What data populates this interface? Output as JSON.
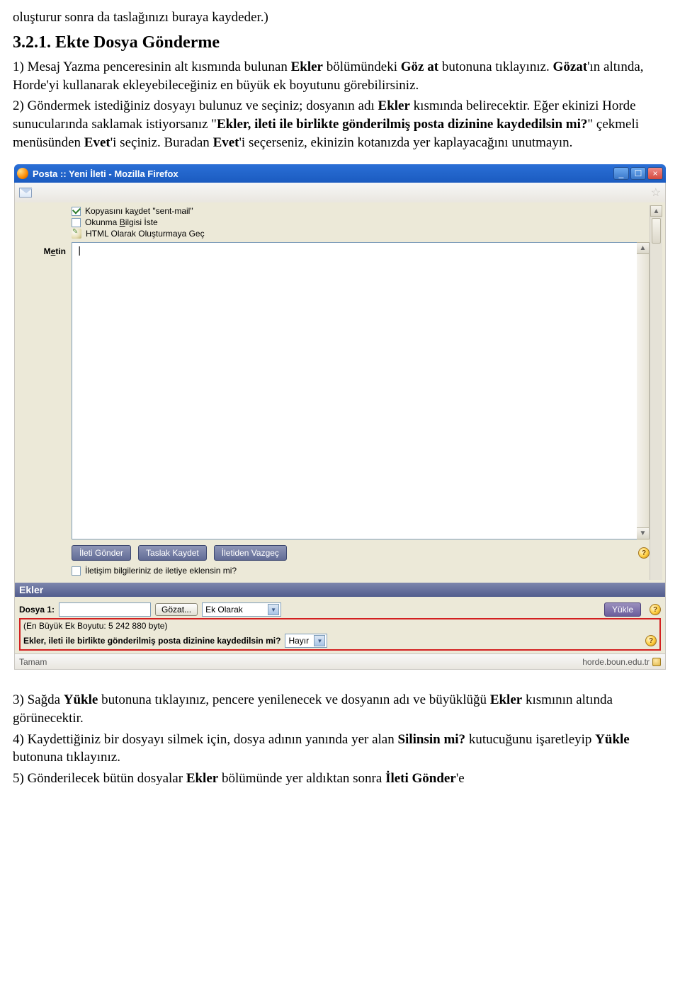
{
  "doc": {
    "pre_text": "oluşturur sonra da taslağınızı buraya kaydeder.)",
    "heading_num": "3.2.1. ",
    "heading_title": "Ekte Dosya Gönderme",
    "para1_a": "1) Mesaj Yazma penceresinin alt kısmında bulunan ",
    "para1_b": "Ekler",
    "para1_c": " bölümündeki ",
    "para1_d": "Göz at",
    "para1_e": " butonuna tıklayınız. ",
    "para1_f": "Gözat",
    "para1_g": "'ın altında, Horde'yi kullanarak ekleyebileceğiniz en büyük ek boyutunu görebilirsiniz.",
    "para2_a": "2) Göndermek istediğiniz dosyayı bulunuz ve seçiniz; dosyanın adı ",
    "para2_b": "Ekler",
    "para2_c": " kısmında belirecektir. Eğer ekinizi Horde sunucularında saklamak istiyorsanız \"",
    "para2_d": "Ekler, ileti ile birlikte gönderilmiş posta dizinine kaydedilsin mi?",
    "para2_e": "\" çekmeli menüsünden ",
    "para2_f": "Evet",
    "para2_g": "'i seçiniz. Buradan ",
    "para2_h": "Evet",
    "para2_i": "'i seçerseniz, ekinizin kotanızda yer kaplayacağını unutmayın.",
    "para3_a": "3) Sağda ",
    "para3_b": "Yükle",
    "para3_c": " butonuna tıklayınız, pencere yenilenecek ve dosyanın adı ve büyüklüğü ",
    "para3_d": "Ekler",
    "para3_e": " kısmının altında görünecektir.",
    "para4_a": "4) Kaydettiğiniz bir dosyayı silmek için, dosya adının yanında yer alan ",
    "para4_b": "Silinsin mi?",
    "para4_c": " kutucuğunu işaretleyip ",
    "para4_d": "Yükle",
    "para4_e": " butonuna tıklayınız.",
    "para5_a": "5) Gönderilecek bütün dosyalar ",
    "para5_b": "Ekler",
    "para5_c": " bölümünde yer aldıktan sonra ",
    "para5_d": "İleti Gönder",
    "para5_e": "'e"
  },
  "window": {
    "title": "Posta :: Yeni İleti - Mozilla Firefox",
    "minimize": "_",
    "maximize": "☐",
    "close": "×"
  },
  "compose": {
    "save_copy_pre": "Kopyasını ka",
    "save_copy_u": "y",
    "save_copy_post": "det \"sent-mail\"",
    "read_receipt_pre": "Okunma ",
    "read_receipt_u": "B",
    "read_receipt_post": "ilgisi İste",
    "html_mode": "HTML Olarak Oluşturmaya Geç",
    "label_metin_pre": "M",
    "label_metin_u": "e",
    "label_metin_post": "tin",
    "textarea_content": "|",
    "btn_send": "İleti Gönder",
    "btn_draft": "Taslak Kaydet",
    "btn_cancel": "İletiden Vazgeç",
    "contact_opt": "İletişim bilgileriniz de iletiye eklensin mi?"
  },
  "attachments": {
    "header": "Ekler",
    "file_label": "Dosya 1:",
    "browse": "Gözat...",
    "disposition": "Ek Olarak",
    "upload": "Yükle",
    "max_size": "(En Büyük Ek Boyutu: 5 242 880 byte)",
    "save_question": "Ekler, ileti ile birlikte gönderilmiş posta dizinine kaydedilsin mi?",
    "option_no": "Hayır"
  },
  "status": {
    "left": "Tamam",
    "right": "horde.boun.edu.tr"
  }
}
